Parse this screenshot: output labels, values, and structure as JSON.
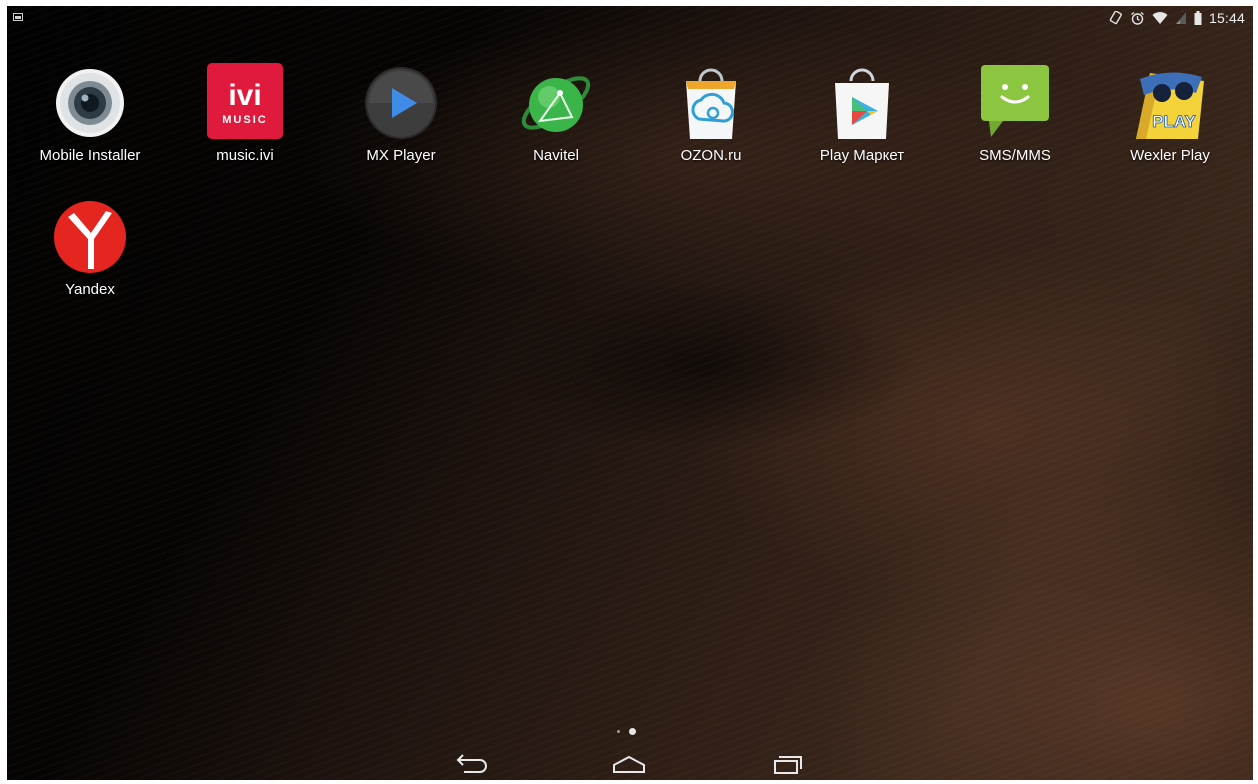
{
  "status_bar": {
    "time": "15:44",
    "left_icon": "screenshot-notification-icon",
    "right_icons": [
      "rotation-lock-icon",
      "alarm-icon",
      "wifi-icon",
      "signal-icon",
      "battery-icon"
    ]
  },
  "apps": [
    {
      "label": "Mobile Installer",
      "icon": "mobile-installer-icon"
    },
    {
      "label": "music.ivi",
      "icon": "music-ivi-icon"
    },
    {
      "label": "MX Player",
      "icon": "mx-player-icon"
    },
    {
      "label": "Navitel",
      "icon": "navitel-icon"
    },
    {
      "label": "OZON.ru",
      "icon": "ozon-icon"
    },
    {
      "label": "Play Маркет",
      "icon": "play-market-icon"
    },
    {
      "label": "SMS/MMS",
      "icon": "sms-mms-icon"
    },
    {
      "label": "Wexler Play",
      "icon": "wexler-play-icon"
    },
    {
      "label": "Yandex",
      "icon": "yandex-icon"
    }
  ],
  "icon_text": {
    "ivi_logo": "ivi",
    "ivi_music": "MUSIC",
    "wexler_play": "PLAY"
  },
  "home_pages": {
    "count": 2,
    "active": 2
  },
  "nav_bar": {
    "buttons": [
      "back-icon",
      "home-icon",
      "recent-apps-icon"
    ]
  }
}
